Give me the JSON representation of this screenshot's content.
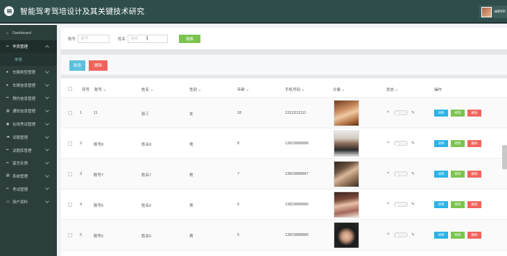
{
  "header": {
    "title": "智能驾考驾培设计及其关键技术研究",
    "user_name": "admin"
  },
  "sidebar": {
    "items": [
      {
        "label": "Dashboard",
        "icon": "home-icon"
      },
      {
        "label": "学员管理",
        "icon": "grid-icon",
        "open": true
      },
      {
        "label": "车辆类型管理",
        "icon": "user-icon"
      },
      {
        "label": "车辆信息管理",
        "icon": "user-icon"
      },
      {
        "label": "预约信息管理",
        "icon": "grid-icon"
      },
      {
        "label": "通知信息管理",
        "icon": "list-icon"
      },
      {
        "label": "在线考试管理",
        "icon": "message-icon"
      },
      {
        "label": "试题管理",
        "icon": "cloud-icon"
      },
      {
        "label": "试题库管理",
        "icon": "grid-icon"
      },
      {
        "label": "留言反馈",
        "icon": "grid-icon"
      },
      {
        "label": "系统管理",
        "icon": "list-icon"
      },
      {
        "label": "考试管理",
        "icon": "grid-icon"
      },
      {
        "label": "用户资料",
        "icon": "doc-icon"
      }
    ],
    "sub_item": "学员"
  },
  "search": {
    "account_label": "账号",
    "account_placeholder": "账号",
    "name_label": "姓名",
    "name_placeholder": "姓名",
    "search_button": "搜索"
  },
  "actions": {
    "add": "新增",
    "delete": "删除"
  },
  "table": {
    "headers": [
      "序号",
      "账号",
      "姓名",
      "性别",
      "年龄",
      "手机号码",
      "头像",
      "状态",
      "操作"
    ],
    "rows": [
      {
        "index": "1",
        "account": "11",
        "name": "张三",
        "gender": "女",
        "age": "18",
        "phone": "13111111111"
      },
      {
        "index": "2",
        "account": "账号8",
        "name": "姓名8",
        "gender": "男",
        "age": "8",
        "phone": "13823888888"
      },
      {
        "index": "3",
        "account": "账号7",
        "name": "姓名7",
        "gender": "男",
        "age": "7",
        "phone": "13823888887"
      },
      {
        "index": "4",
        "account": "账号6",
        "name": "姓名6",
        "gender": "男",
        "age": "6",
        "phone": "13823888886"
      },
      {
        "index": "5",
        "account": "账号5",
        "name": "姓名5",
        "gender": "男",
        "age": "5",
        "phone": "13823888885"
      }
    ],
    "row_buttons": {
      "detail": "详情",
      "edit": "修改",
      "delete": "删除"
    }
  },
  "colors": {
    "header_bg": "#2f4e4b",
    "sidebar_bg": "#2c3e3b",
    "add_button": "#5bc0de",
    "delete_button": "#f0645c",
    "search_button": "#7bc44f"
  }
}
